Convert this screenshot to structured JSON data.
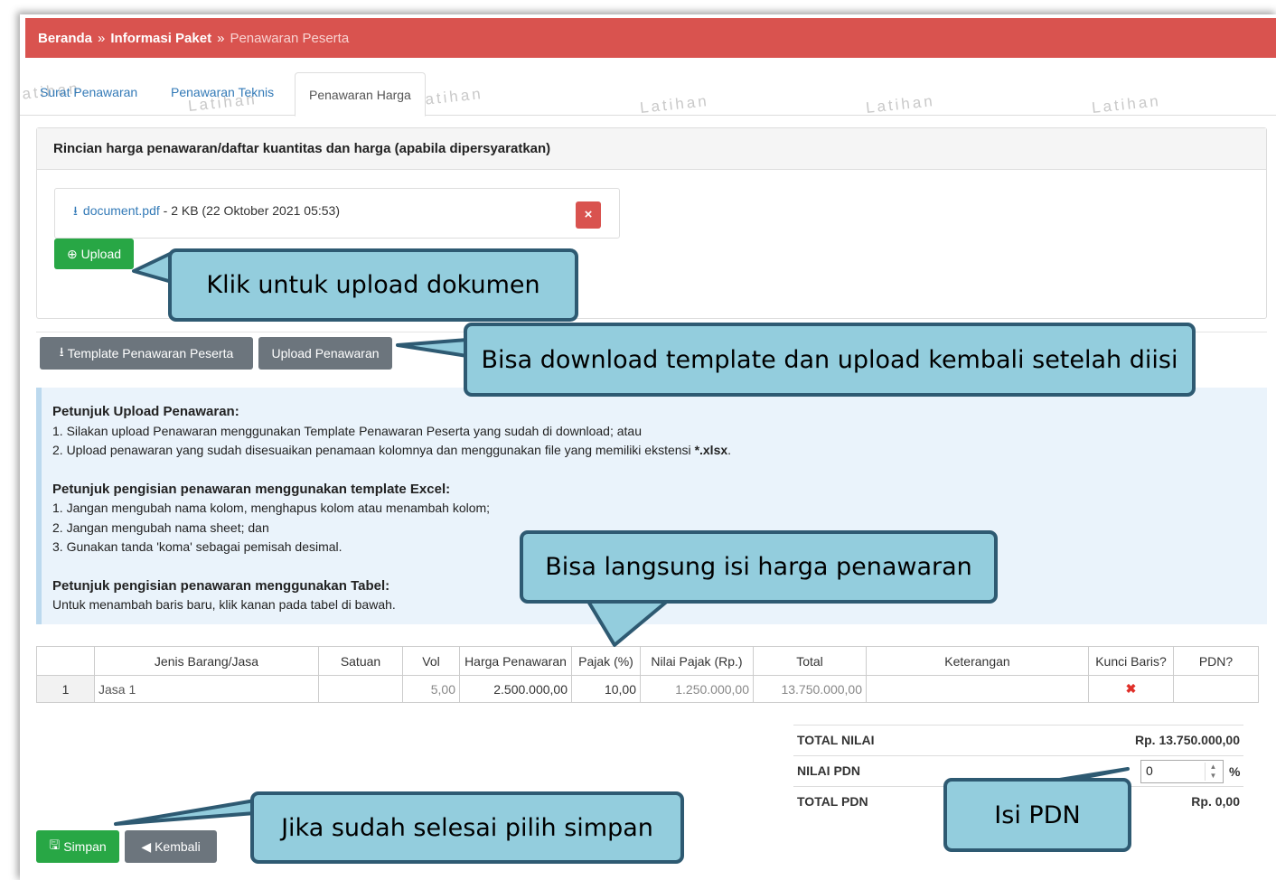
{
  "breadcrumb": {
    "home": "Beranda",
    "sep1": "»",
    "package": "Informasi Paket",
    "sep2": "»",
    "current": "Penawaran Peserta"
  },
  "tabs": [
    {
      "label": "Surat Penawaran"
    },
    {
      "label": "Penawaran Teknis"
    },
    {
      "label": "Penawaran Harga"
    }
  ],
  "watermark": "Latihan",
  "panel": {
    "title": "Rincian harga penawaran/daftar kuantitas dan harga (apabila dipersyaratkan)",
    "file_name": "document.pdf",
    "file_meta": " - 2 KB (22 Oktober 2021 05:53)",
    "delete_label": "×",
    "upload_label": "Upload"
  },
  "actions": {
    "template_label": "Template Penawaran Peserta",
    "upload_offer_label": "Upload Penawaran"
  },
  "instructions": {
    "h1": "Petunjuk Upload Penawaran:",
    "l1": "1. Silakan upload Penawaran menggunakan Template Penawaran Peserta yang sudah di download; atau",
    "l2_pre": "2. Upload penawaran yang sudah disesuaikan penamaan kolomnya dan menggunakan file yang memiliki ekstensi ",
    "l2_ext": "*.xlsx",
    "l2_post": ".",
    "h2": "Petunjuk pengisian penawaran menggunakan template Excel:",
    "m1": "1. Jangan mengubah nama kolom, menghapus kolom atau menambah kolom;",
    "m2": "2. Jangan mengubah nama sheet; dan",
    "m3": "3. Gunakan tanda 'koma' sebagai pemisah desimal.",
    "h3": "Petunjuk pengisian penawaran menggunakan Tabel:",
    "n1": "Untuk menambah baris baru, klik kanan pada tabel di bawah."
  },
  "table": {
    "headers": [
      "",
      "Jenis Barang/Jasa",
      "Satuan",
      "Vol",
      "Harga Penawaran",
      "Pajak (%)",
      "Nilai Pajak (Rp.)",
      "Total",
      "Keterangan",
      "Kunci Baris?",
      "PDN?"
    ],
    "rows": [
      {
        "no": "1",
        "item": "Jasa 1",
        "unit": "",
        "vol": "5,00",
        "price": "2.500.000,00",
        "tax_pct": "10,00",
        "tax_value": "1.250.000,00",
        "total": "13.750.000,00",
        "note": "",
        "lock": "✖",
        "pdn": ""
      }
    ]
  },
  "totals": {
    "total_label": "TOTAL NILAI",
    "total_value": "Rp. 13.750.000,00",
    "pdn_label": "NILAI PDN",
    "pdn_input": "0",
    "pdn_unit": "%",
    "total_pdn_label": "TOTAL PDN",
    "total_pdn_value": "Rp. 0,00"
  },
  "buttons": {
    "save": "Simpan",
    "back": "Kembali"
  },
  "callouts": {
    "upload": "Klik untuk upload dokumen",
    "template": "Bisa download template dan upload kembali setelah diisi",
    "price": "Bisa langsung isi harga penawaran",
    "save": "Jika sudah selesai pilih simpan",
    "pdn": "Isi PDN"
  },
  "colors": {
    "header_red": "#d9534f",
    "success_green": "#28a745",
    "callout_fill": "#93cddd",
    "callout_border": "#2e5a72",
    "link_blue": "#337ab7"
  }
}
